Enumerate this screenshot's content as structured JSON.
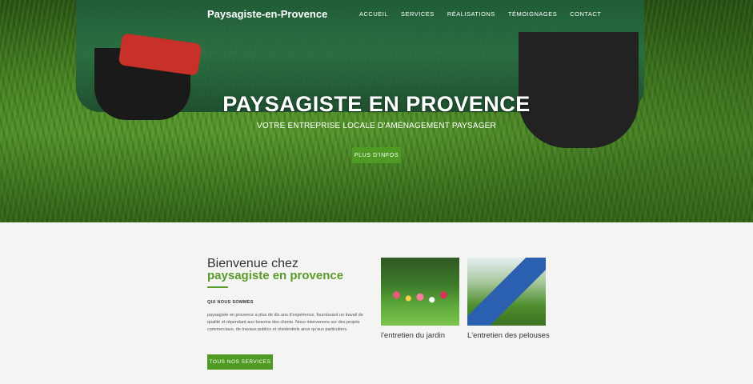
{
  "nav": {
    "brand": "Paysagiste-en-Provence",
    "links": [
      "ACCUEIL",
      "SERVICES",
      "RÉALISATIONS",
      "TÉMOIGNAGES",
      "CONTACT"
    ]
  },
  "hero": {
    "title": "PAYSAGISTE EN PROVENCE",
    "subtitle": "VOTRE ENTREPRISE LOCALE D'AMÉNAGEMENT PAYSAGER",
    "button": "PLUS D'INFOS"
  },
  "welcome": {
    "line1": "Bienvenue chez",
    "line2": "paysagiste en provence",
    "label": "QUI NOUS SOMMES",
    "text": "paysagiste en provence a plus de dix ans d'expérience, fournissant un travail de qualité et répondant aux besoins des clients. Nous intervenons sur des projets commerciaux, de travaux publics et résidentiels ainsi qu'aux particuliers.",
    "button": "TOUS NOS SERVICES"
  },
  "cards": [
    {
      "caption": "l'entretien du jardin"
    },
    {
      "caption": "L'entretien des pelouses"
    }
  ],
  "colors": {
    "accent": "#4e9a22",
    "accent_text": "#5a9a2a"
  }
}
